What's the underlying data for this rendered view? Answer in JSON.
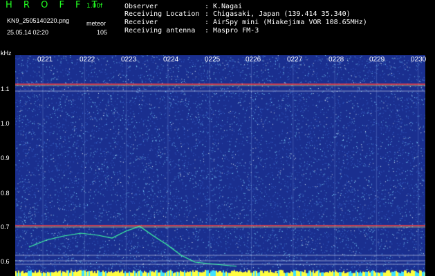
{
  "header": {
    "logo": "H R O F F T",
    "version": "1.00f",
    "filename": "KN9_2505140220.png",
    "mode": "meteor",
    "datetime": "25.05.14 02:20",
    "count": "105"
  },
  "info": [
    {
      "label": "Observer",
      "value": "K.Nagai"
    },
    {
      "label": "Receiving Location",
      "value": "Chigasaki, Japan (139.414 35.340)"
    },
    {
      "label": "Receiver",
      "value": "AirSpy mini (Miakejima VOR 108.65MHz)"
    },
    {
      "label": "Receiving antenna",
      "value": "Maspro FM-3"
    }
  ],
  "colon": ":",
  "plot": {
    "y_unit": "kHz",
    "y_ticks": [
      "1.1",
      "1.0",
      "0.9",
      "0.8",
      "0.7",
      "0.6"
    ],
    "x_ticks": [
      "0221",
      "0222",
      "0223",
      "0224",
      "0225",
      "0226",
      "0227",
      "0228",
      "0229",
      "0230"
    ],
    "colors": {
      "background": "#1a2f8f",
      "noise": "#7fd8ff",
      "carrier": "#ff4040",
      "echo": "#40ffa0"
    }
  }
}
